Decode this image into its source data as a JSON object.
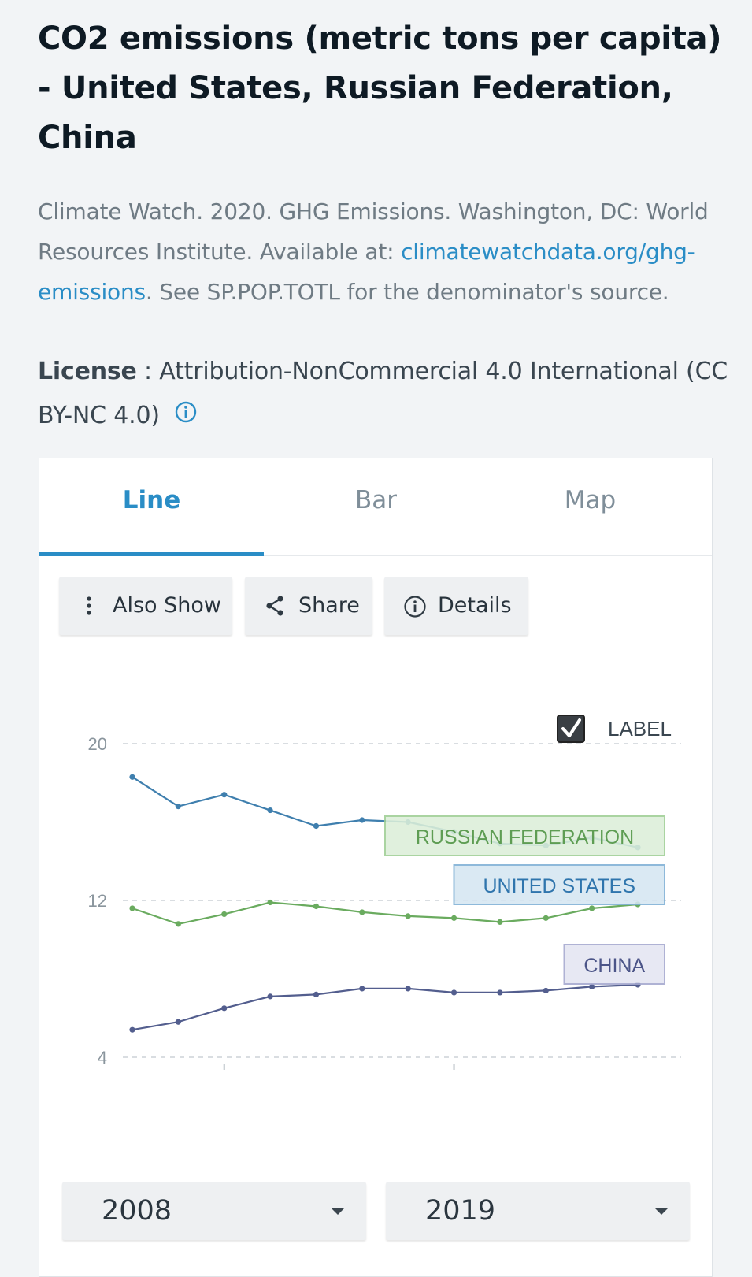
{
  "title": "CO2 emissions (metric tons per capita) - United States, Russian Federation, China",
  "source": {
    "text_before": "Climate Watch. 2020. GHG Emissions. Washington, DC: World Resources Institute. Available at: ",
    "link": "climatewatchdata.org/ghg-emissions",
    "text_after": ". See SP.POP.TOTL for the denominator's source."
  },
  "license": {
    "label": "License",
    "separator": " : ",
    "value": "Attribution-NonCommercial 4.0 International (CC BY-NC 4.0)"
  },
  "tabs": [
    {
      "label": "Line",
      "active": true
    },
    {
      "label": "Bar",
      "active": false
    },
    {
      "label": "Map",
      "active": false
    }
  ],
  "toolbar": {
    "also_show": "Also Show",
    "share": "Share",
    "details": "Details"
  },
  "label_toggle": {
    "text": "LABEL",
    "checked": true
  },
  "range": {
    "start": "2008",
    "end": "2019"
  },
  "colors": {
    "accent": "#2a8dc6",
    "united_states": "#3f7fae",
    "russian_federation": "#6aab5f",
    "china": "#535e8e"
  },
  "chart_data": {
    "type": "line",
    "x": [
      2008,
      2009,
      2010,
      2011,
      2012,
      2013,
      2014,
      2015,
      2016,
      2017,
      2018,
      2019
    ],
    "ylim": [
      4,
      20
    ],
    "yticks": [
      4,
      12,
      20
    ],
    "grid": true,
    "series": [
      {
        "name": "UNITED STATES",
        "color": "#3f7fae",
        "values": [
          18.3,
          16.8,
          17.4,
          16.6,
          15.8,
          16.1,
          16.0,
          15.5,
          14.9,
          14.8,
          15.2,
          14.7
        ]
      },
      {
        "name": "RUSSIAN FEDERATION",
        "color": "#6aab5f",
        "values": [
          11.6,
          10.8,
          11.3,
          11.9,
          11.7,
          11.4,
          11.2,
          11.1,
          10.9,
          11.1,
          11.6,
          11.8
        ]
      },
      {
        "name": "CHINA",
        "color": "#535e8e",
        "values": [
          5.4,
          5.8,
          6.5,
          7.1,
          7.2,
          7.5,
          7.5,
          7.3,
          7.3,
          7.4,
          7.6,
          7.7
        ]
      }
    ],
    "direct_labels": true
  }
}
